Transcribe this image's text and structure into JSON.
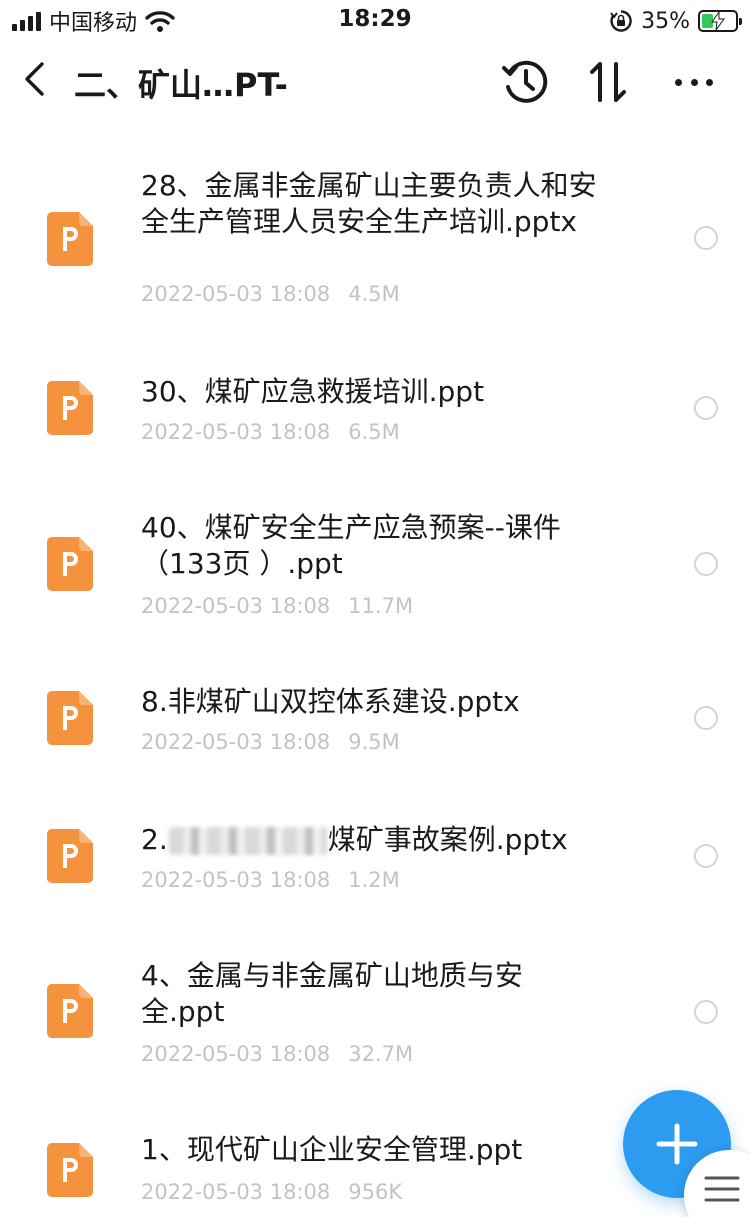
{
  "status_bar": {
    "carrier": "中国移动",
    "time": "18:29",
    "battery_percent": "35%",
    "battery_level": 0.35,
    "signal_bars": 4,
    "icons": [
      "signal-icon",
      "wifi-icon",
      "rotation-lock-icon",
      "battery-charging-icon"
    ]
  },
  "nav": {
    "title": "二、矿山…PT-",
    "icons": [
      "back-icon",
      "history-icon",
      "sort-icon",
      "more-icon"
    ]
  },
  "files": [
    {
      "name": "28、金属非金属矿山主要负责人和安全生产管理人员安全生产培训.pptx",
      "date": "2022-05-03 18:08",
      "size": "4.5M"
    },
    {
      "name": "30、煤矿应急救援培训.ppt",
      "date": "2022-05-03 18:08",
      "size": "6.5M"
    },
    {
      "name": "40、煤矿安全生产应急预案--课件（133页 ）.ppt",
      "date": "2022-05-03 18:08",
      "size": "11.7M"
    },
    {
      "name": "8.非煤矿山双控体系建设.pptx",
      "date": "2022-05-03 18:08",
      "size": "9.5M"
    },
    {
      "name_prefix": "2.",
      "name_suffix": "煤矿事故案例.pptx",
      "date": "2022-05-03 18:08",
      "size": "1.2M"
    },
    {
      "name": "4、金属与非金属矿山地质与安全.ppt",
      "date": "2022-05-03 18:08",
      "size": "32.7M"
    },
    {
      "name": "1、现代矿山企业安全管理.ppt",
      "date": "2022-05-03 18:08",
      "size": "956K"
    }
  ],
  "colors": {
    "ppt_icon": "#f5923e",
    "fab": "#2d9bf0",
    "meta_text": "#c3c3c3"
  }
}
